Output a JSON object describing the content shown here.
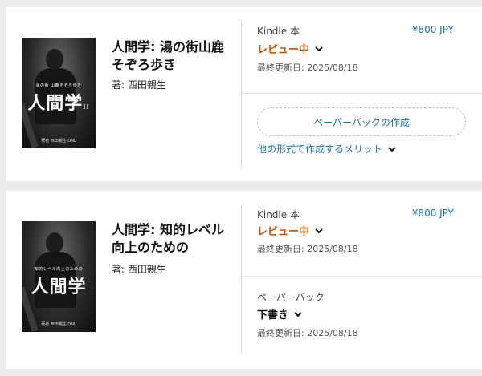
{
  "books": [
    {
      "cover": {
        "subtitle": "湯の街 山鹿そぞろ歩き",
        "title": "人間学",
        "title_suffix": "II",
        "author": "著者 西田親生 DNL"
      },
      "title": "人間学: 湯の街山鹿そぞろ歩き",
      "author": "著: 西田親生",
      "kindle": {
        "label": "Kindle 本",
        "price": "¥800 JPY",
        "status": "レビュー中",
        "updated": "最終更新日: 2025/08/18"
      },
      "paperback_button": "ペーパーバックの作成",
      "other_formats_link": "他の形式で作成するメリット"
    },
    {
      "cover": {
        "subtitle": "知的レベル向上のための",
        "title": "人間学",
        "author": "著者 西田親生 DNL"
      },
      "title": "人間学: 知的レベル向上のための",
      "author": "著: 西田親生",
      "kindle": {
        "label": "Kindle 本",
        "price": "¥800 JPY",
        "status": "レビュー中",
        "updated": "最終更新日: 2025/08/18"
      },
      "paperback": {
        "label": "ペーパーバック",
        "status": "下書き",
        "updated": "最終更新日: 2025/08/18"
      }
    }
  ],
  "colors": {
    "link": "#1a6fa8",
    "review_status": "#c45500",
    "background": "#ececec"
  }
}
